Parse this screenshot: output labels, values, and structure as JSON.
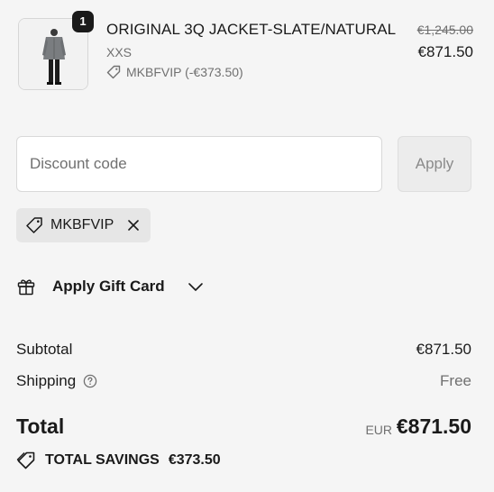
{
  "line_item": {
    "quantity": "1",
    "title": "ORIGINAL 3Q JACKET-SLATE/NATURAL",
    "variant": "XXS",
    "discount": "MKBFVIP (-€373.50)",
    "original_price": "€1,245.00",
    "price": "€871.50"
  },
  "discount_form": {
    "placeholder": "Discount code",
    "apply_label": "Apply"
  },
  "applied_code": "MKBFVIP",
  "gift_card": {
    "label": "Apply Gift Card"
  },
  "summary": {
    "subtotal_label": "Subtotal",
    "subtotal_value": "€871.50",
    "shipping_label": "Shipping",
    "shipping_value": "Free",
    "total_label": "Total",
    "total_currency": "EUR",
    "total_value": "€871.50",
    "savings_label": "TOTAL SAVINGS",
    "savings_value": "€373.50"
  },
  "icons": {
    "thumbnail": "product-photo",
    "discount_tag": "tag-icon",
    "remove": "close-icon",
    "gift": "gift-icon",
    "expand": "chevron-down-icon",
    "help": "help-circle-icon",
    "savings": "tag-icon"
  }
}
